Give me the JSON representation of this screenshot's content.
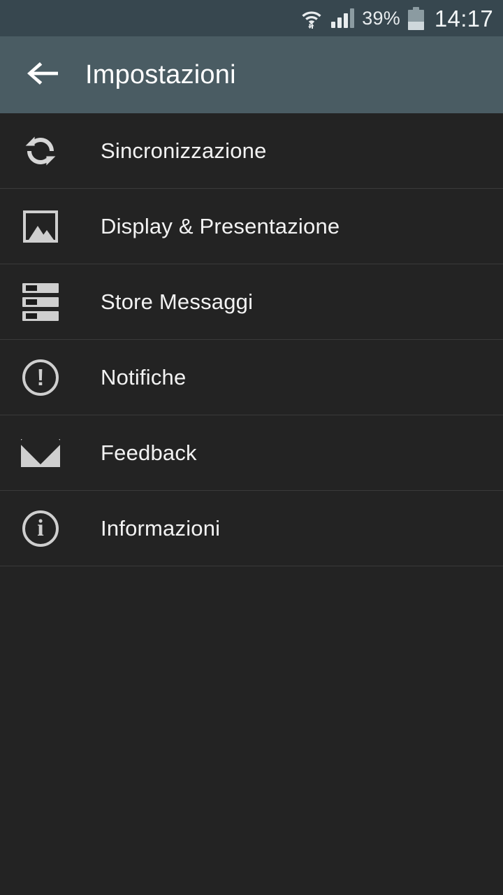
{
  "status_bar": {
    "wifi_icon": "wifi-transfer-icon",
    "signal_icon": "cellular-signal-icon",
    "signal_bars_filled": 3,
    "signal_bars_total": 4,
    "battery_percent_label": "39%",
    "battery_level": 39,
    "battery_icon": "battery-icon",
    "clock": "14:17",
    "background_color": "#37474F"
  },
  "app_bar": {
    "back_icon": "back-arrow-icon",
    "title": "Impostazioni",
    "background_color": "#4A5C63",
    "title_color": "#FFFFFF"
  },
  "settings": {
    "background_color": "#232323",
    "divider_color": "#3A3A3A",
    "label_color": "#F2F2F2",
    "icon_color": "#CFCFCF",
    "items": [
      {
        "label": "Sincronizzazione",
        "icon": "sync-icon"
      },
      {
        "label": "Display & Presentazione",
        "icon": "picture-icon"
      },
      {
        "label": "Store Messaggi",
        "icon": "list-stack-icon"
      },
      {
        "label": "Notifiche",
        "icon": "exclamation-circle-icon",
        "glyph": "!"
      },
      {
        "label": "Feedback",
        "icon": "envelope-icon"
      },
      {
        "label": "Informazioni",
        "icon": "info-circle-icon",
        "glyph": "i"
      }
    ]
  }
}
